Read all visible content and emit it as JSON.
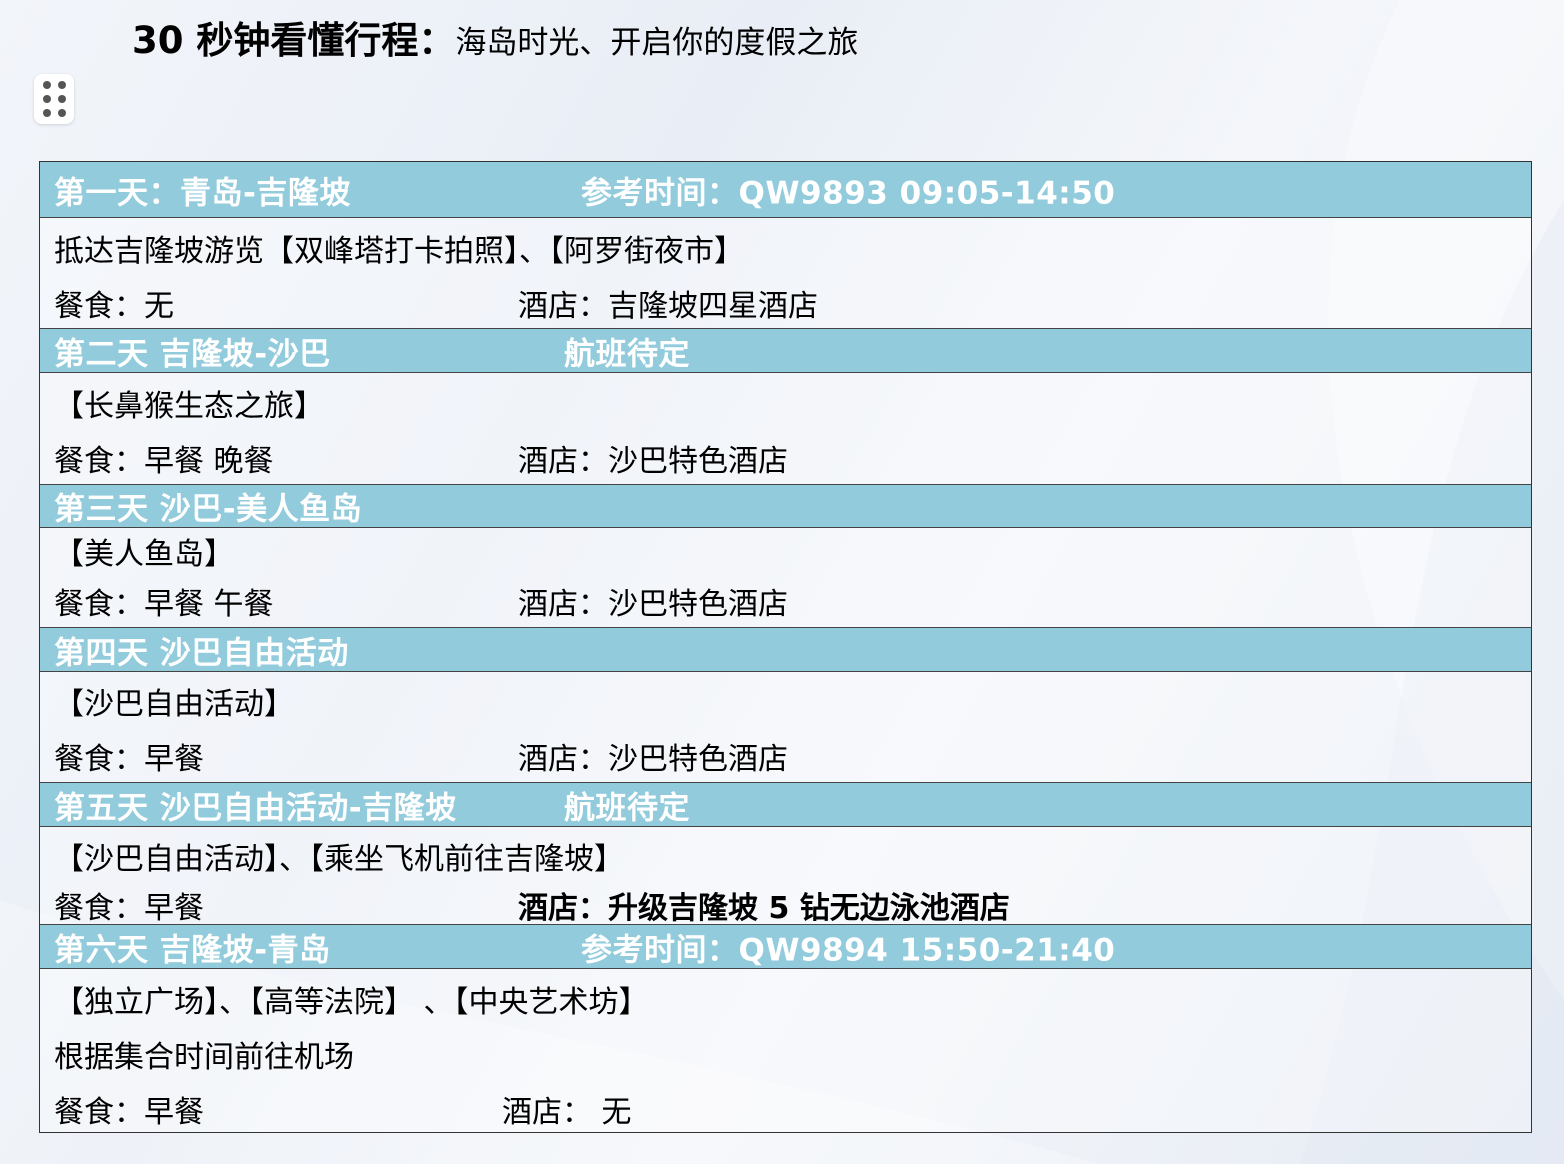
{
  "title": {
    "bold": "30 秒钟看懂行程：",
    "subtitle": "海岛时光、开启你的度假之旅"
  },
  "days": [
    {
      "header": "第一天：青岛-吉隆坡",
      "flight": "参考时间：QW9893    09:05-14:50",
      "activities": [
        "抵达吉隆坡游览【双峰塔打卡拍照】、【阿罗街夜市】"
      ],
      "meal": "餐食：无",
      "hotel": "酒店：吉隆坡四星酒店"
    },
    {
      "header": "第二天  吉隆坡-沙巴",
      "flight": "航班待定",
      "activities": [
        "【长鼻猴生态之旅】"
      ],
      "meal": "餐食：早餐  晚餐",
      "hotel": "酒店：沙巴特色酒店"
    },
    {
      "header": "第三天  沙巴-美人鱼岛",
      "flight": "",
      "activities": [
        "【美人鱼岛】"
      ],
      "meal": "餐食：早餐  午餐",
      "hotel": "酒店：沙巴特色酒店"
    },
    {
      "header": "第四天  沙巴自由活动",
      "flight": "",
      "activities": [
        "【沙巴自由活动】"
      ],
      "meal": "餐食：早餐",
      "hotel": "酒店：沙巴特色酒店"
    },
    {
      "header": "第五天  沙巴自由活动-吉隆坡",
      "flight": "航班待定",
      "activities": [
        "【沙巴自由活动】、【乘坐飞机前往吉隆坡】"
      ],
      "meal": "餐食：早餐",
      "hotel": "酒店：升级吉隆坡 5 钻无边泳池酒店"
    },
    {
      "header": "第六天  吉隆坡-青岛",
      "flight": "参考时间：QW9894 15:50-21:40",
      "activities": [
        "【独立广场】、【高等法院】 、【中央艺术坊】",
        "根据集合时间前往机场"
      ],
      "meal": "餐食：早餐",
      "hotel": "酒店：  无"
    }
  ]
}
